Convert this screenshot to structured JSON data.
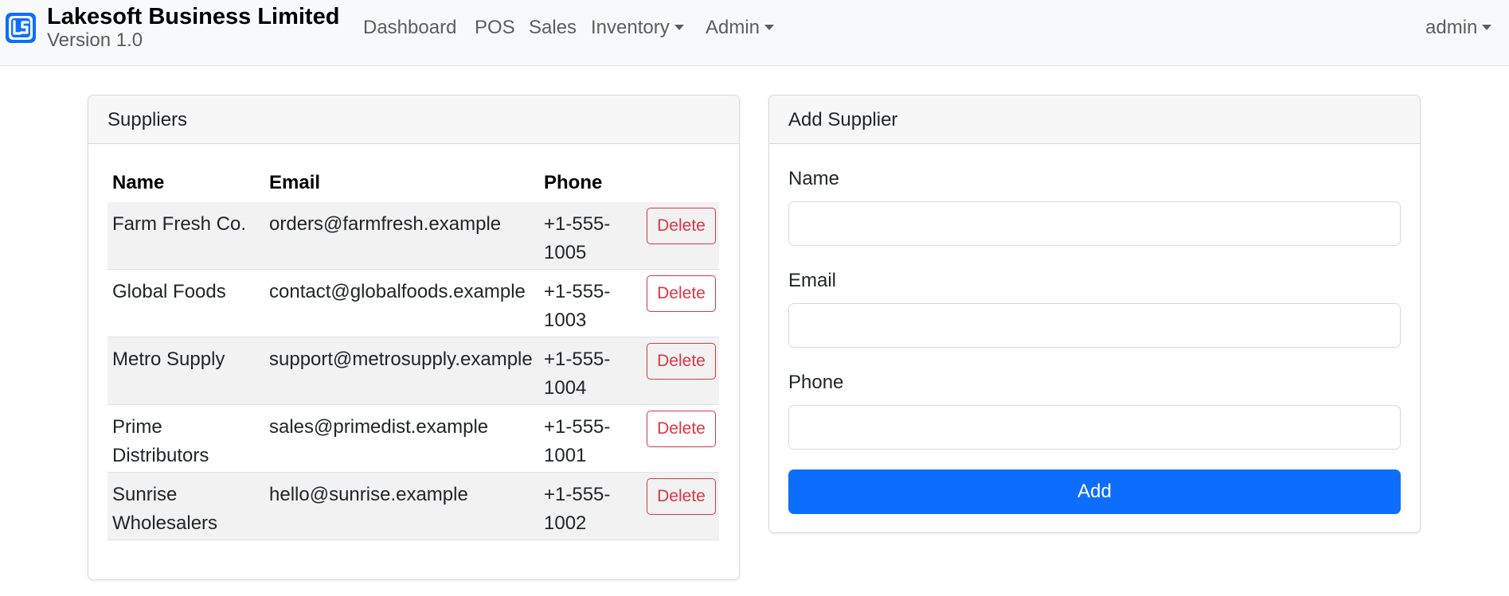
{
  "brand": {
    "logo_icon": "ls-logo-icon",
    "title": "Lakesoft Business Limited",
    "version": "Version 1.0",
    "accent_color": "#0d6efd"
  },
  "nav": {
    "items": [
      {
        "label": "Dashboard",
        "has_dropdown": false
      },
      {
        "label": "POS",
        "has_dropdown": false
      },
      {
        "label": "Sales",
        "has_dropdown": false
      },
      {
        "label": "Inventory",
        "has_dropdown": true
      },
      {
        "label": "Admin",
        "has_dropdown": true
      }
    ],
    "user": {
      "label": "admin",
      "has_dropdown": true
    }
  },
  "suppliers": {
    "title": "Suppliers",
    "columns": [
      "Name",
      "Email",
      "Phone"
    ],
    "delete_label": "Delete",
    "rows": [
      {
        "name": "Farm Fresh Co.",
        "email": "orders@farmfresh.example",
        "phone": "+1-555-1005"
      },
      {
        "name": "Global Foods",
        "email": "contact@globalfoods.example",
        "phone": "+1-555-1003"
      },
      {
        "name": "Metro Supply",
        "email": "support@metrosupply.example",
        "phone": "+1-555-1004"
      },
      {
        "name": "Prime Distributors",
        "email": "sales@primedist.example",
        "phone": "+1-555-1001"
      },
      {
        "name": "Sunrise Wholesalers",
        "email": "hello@sunrise.example",
        "phone": "+1-555-1002"
      }
    ]
  },
  "add_supplier": {
    "title": "Add Supplier",
    "name_label": "Name",
    "name_value": "",
    "email_label": "Email",
    "email_value": "",
    "phone_label": "Phone",
    "phone_value": "",
    "submit_label": "Add"
  }
}
